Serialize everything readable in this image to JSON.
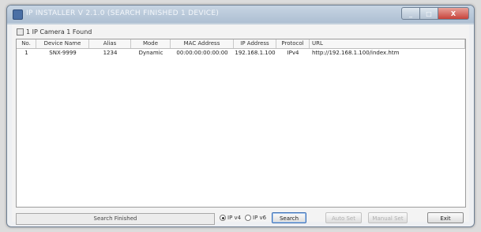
{
  "window": {
    "title": "IP INSTALLER V 2.1.0 (SEARCH FINISHED 1 DEVICE)",
    "minimize_glyph": "_",
    "maximize_glyph": "□",
    "close_glyph": "X"
  },
  "summary": {
    "text": "1 IP Camera 1 Found"
  },
  "table": {
    "columns": [
      "No.",
      "Device Name",
      "Alias",
      "Mode",
      "MAC Address",
      "IP Address",
      "Protocol",
      "URL"
    ],
    "rows": [
      {
        "no": "1",
        "device_name": "SNX-9999",
        "alias": "1234",
        "mode": "Dynamic",
        "mac": "00:00:00:00:00:00",
        "ip": "192.168.1.100",
        "protocol": "IPv4",
        "url": "http://192.168.1.100/index.htm"
      }
    ]
  },
  "footer": {
    "status_text": "Search Finished",
    "ipv4_label": "IP v4",
    "ipv6_label": "IP v6",
    "ipv4_selected": true,
    "search_button": "Search",
    "auto_set_button": "Auto Set",
    "manual_set_button": "Manual Set",
    "exit_button": "Exit"
  }
}
